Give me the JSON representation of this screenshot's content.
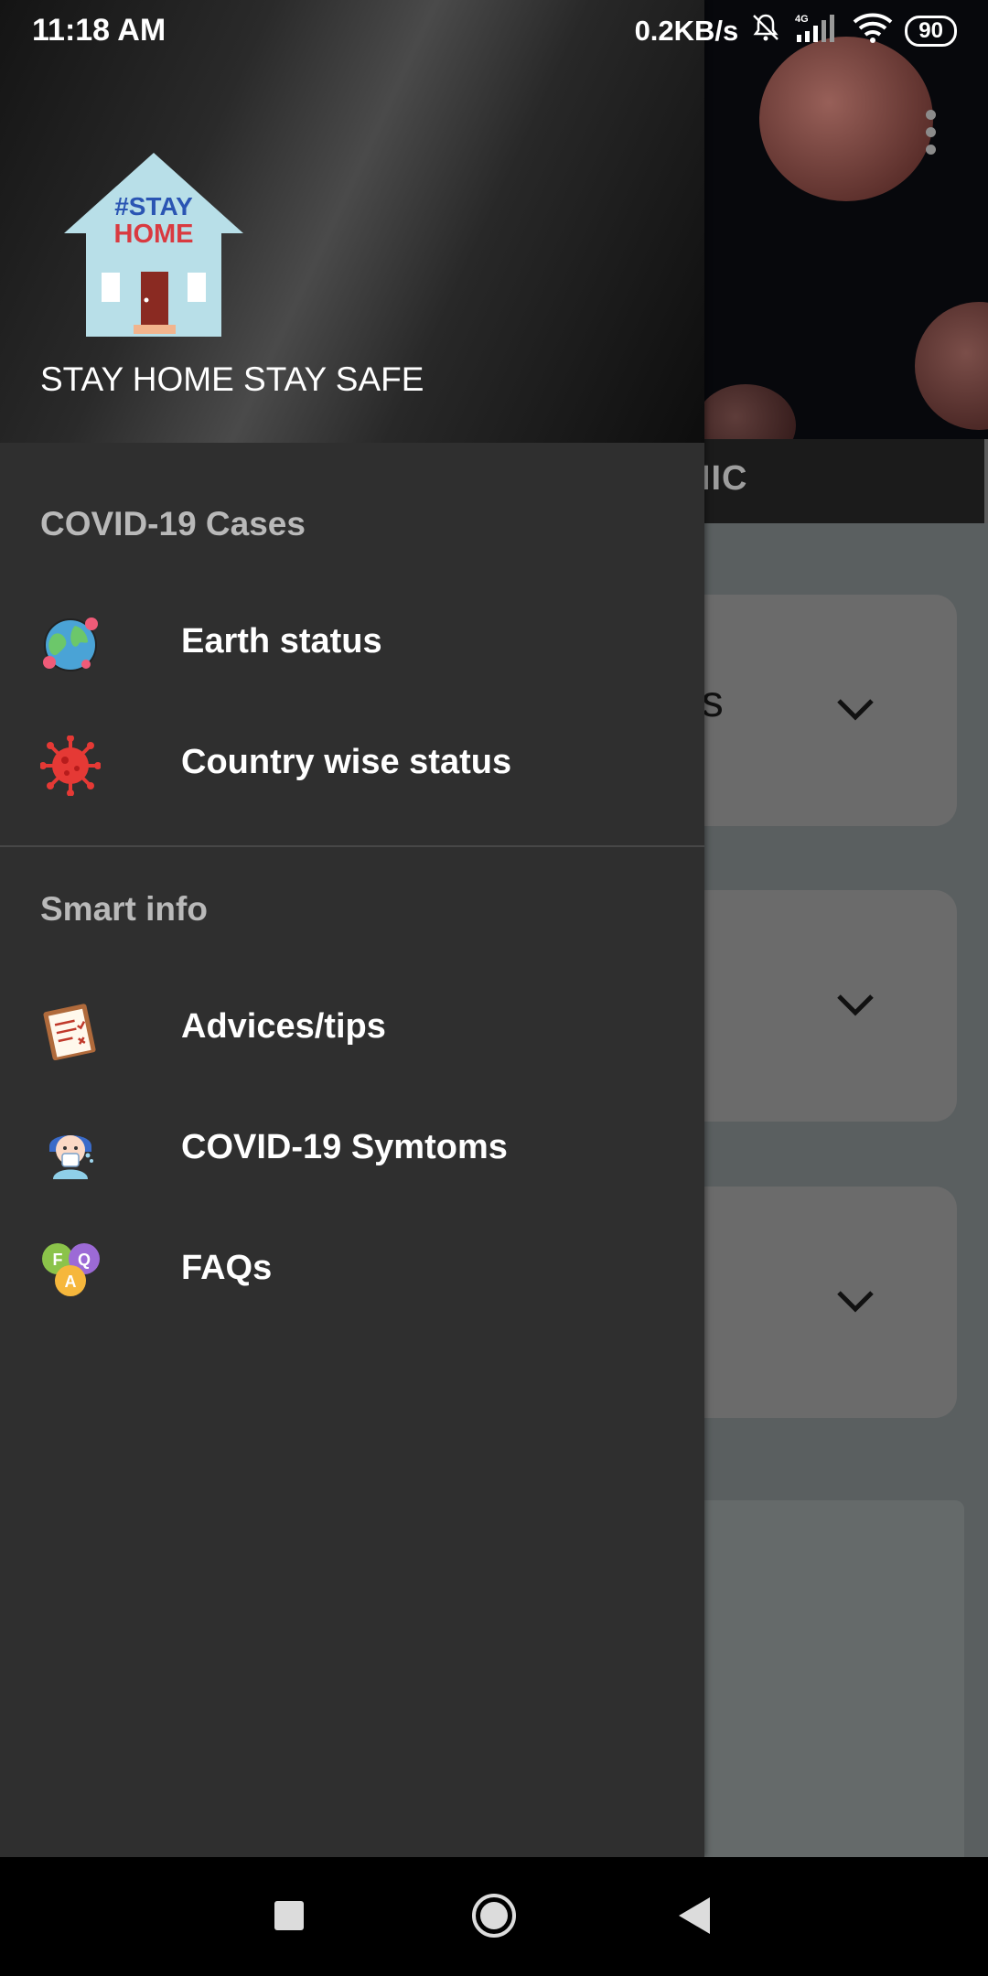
{
  "status_bar": {
    "time": "11:18 AM",
    "network_speed": "0.2KB/s",
    "network_type": "4G",
    "battery": "90"
  },
  "drawer": {
    "header_title": "STAY HOME STAY SAFE",
    "logo_text_line1": "#STAY",
    "logo_text_line2": "HOME",
    "sections": [
      {
        "label": "COVID-19 Cases",
        "items": [
          {
            "label": "Earth status",
            "icon": "globe-icon"
          },
          {
            "label": "Country wise status",
            "icon": "virus-icon"
          }
        ]
      },
      {
        "label": "Smart info",
        "items": [
          {
            "label": "Advices/tips",
            "icon": "clipboard-icon"
          },
          {
            "label": "COVID-19 Symtoms",
            "icon": "sneezing-person-icon"
          },
          {
            "label": "FAQs",
            "icon": "faq-bubbles-icon"
          }
        ]
      }
    ]
  },
  "background_app": {
    "tab_fragment": "DEMIC",
    "card_fragment": "es"
  },
  "colors": {
    "drawer_bg": "#2f2f2f",
    "section_label": "#b9b9b9",
    "card_bg": "#6b6b6b",
    "accent_red": "#e53935"
  }
}
